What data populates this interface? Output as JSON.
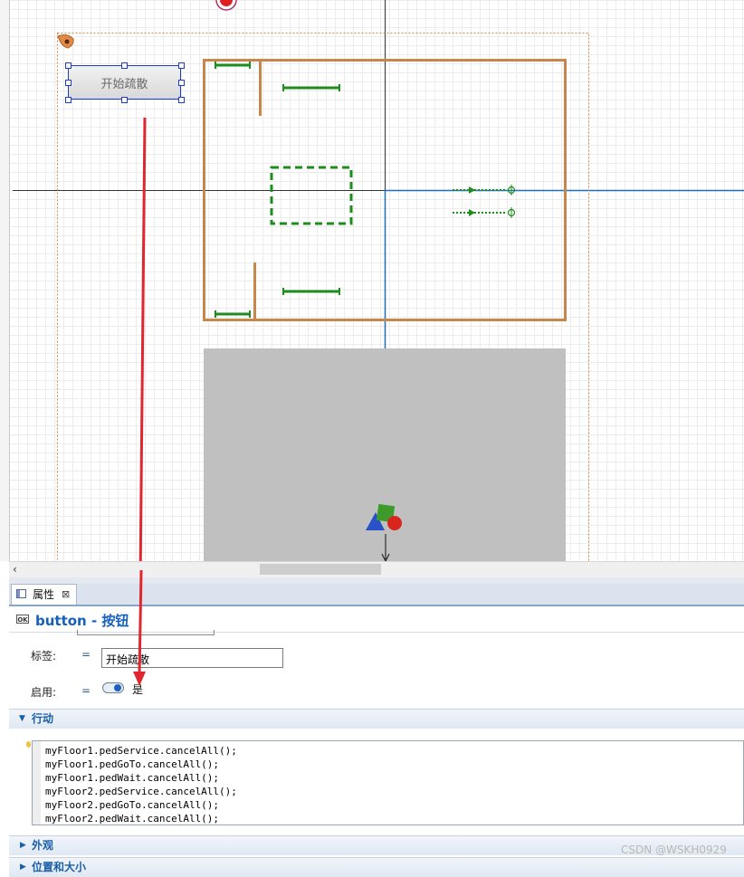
{
  "canvas": {
    "button_label": "开始疏散"
  },
  "props": {
    "tab_label": "属性",
    "header_title": "button - 按钮",
    "header_icon": "OK",
    "label_field_label": "标签:",
    "label_field_value": "开始疏散",
    "enabled_label": "启用:",
    "enabled_value": "是",
    "section_action": "行动",
    "section_appearance": "外观",
    "section_position": "位置和大小",
    "code_lines": [
      "myFloor1.pedService.cancelAll();",
      "myFloor1.pedGoTo.cancelAll();",
      "myFloor1.pedWait.cancelAll();",
      "myFloor2.pedService.cancelAll();",
      "myFloor2.pedGoTo.cancelAll();",
      "myFloor2.pedWait.cancelAll();"
    ]
  },
  "watermark": "CSDN @WSKH0929",
  "colors": {
    "wall": "#c8874a",
    "path": "#1e8c1e",
    "annotation_arrow": "#e0262e",
    "axis_blue": "#1f6fbf",
    "floor_gray": "#c0c0c0",
    "selection": "#1d3fbf"
  }
}
